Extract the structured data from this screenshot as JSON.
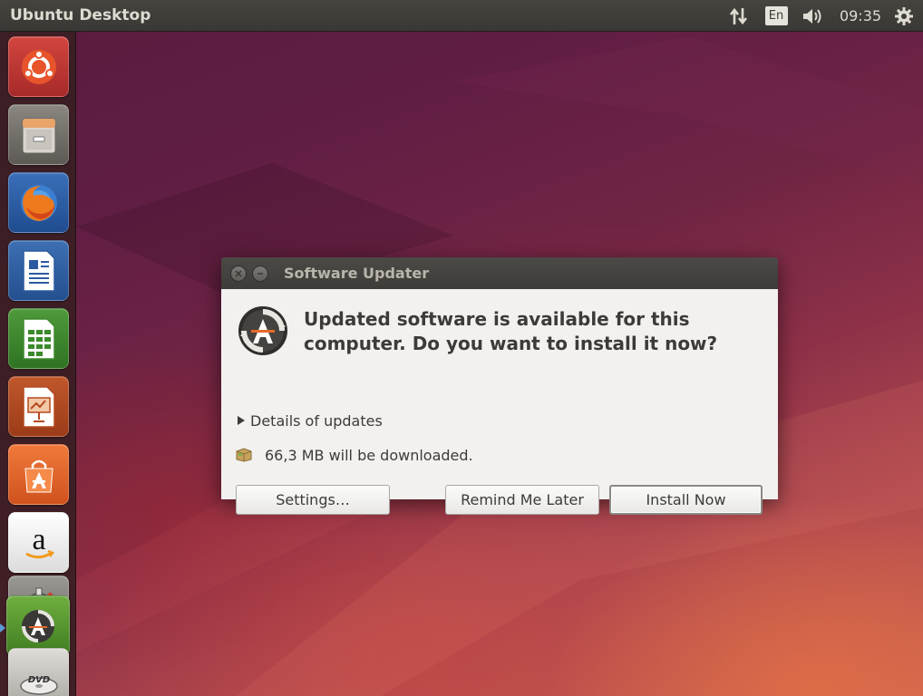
{
  "panel": {
    "title": "Ubuntu Desktop",
    "keyboard_layout": "En",
    "clock": "09:35",
    "indicators": [
      "network-icon",
      "keyboard-layout-indicator",
      "sound-icon",
      "clock",
      "system-gear-icon"
    ]
  },
  "launcher": {
    "items": [
      {
        "name": "ubuntu-dash-icon"
      },
      {
        "name": "files-icon"
      },
      {
        "name": "firefox-icon"
      },
      {
        "name": "libreoffice-writer-icon"
      },
      {
        "name": "libreoffice-calc-icon"
      },
      {
        "name": "libreoffice-impress-icon"
      },
      {
        "name": "ubuntu-software-center-icon"
      },
      {
        "name": "amazon-icon",
        "glyph": "a"
      },
      {
        "name": "system-settings-icon"
      },
      {
        "name": "software-updater-icon",
        "running": true
      },
      {
        "name": "dvd-icon",
        "label": "DVD"
      }
    ]
  },
  "dialog": {
    "title": "Software Updater",
    "headline": "Updated software is available for this computer. Do you want to install it now?",
    "details_label": "Details of updates",
    "download_text": "66,3 MB will be downloaded.",
    "buttons": {
      "settings": "Settings…",
      "remind": "Remind Me Later",
      "install": "Install Now"
    }
  },
  "colors": {
    "panel": "#3c3b37",
    "dialog_body": "#f2f1f0",
    "wallpaper_dark": "#5e1d42",
    "wallpaper_light": "#d06a4e",
    "ubuntu_orange": "#dd4814"
  }
}
